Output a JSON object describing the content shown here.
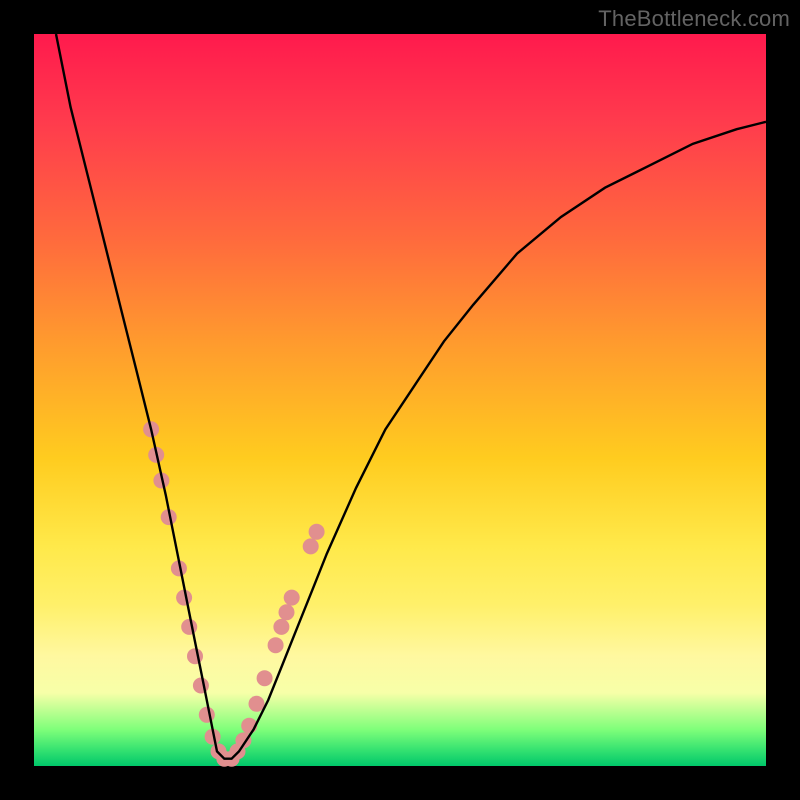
{
  "watermark": "TheBottleneck.com",
  "chart_data": {
    "type": "line",
    "title": "",
    "xlabel": "",
    "ylabel": "",
    "xlim": [
      0,
      100
    ],
    "ylim": [
      0,
      100
    ],
    "grid": false,
    "legend": false,
    "series": [
      {
        "name": "curve",
        "color": "#000000",
        "x": [
          3,
          5,
          8,
          10,
          12,
          14,
          16,
          18,
          19,
          20,
          21,
          22,
          23,
          24,
          25,
          26,
          27,
          28,
          30,
          32,
          34,
          36,
          38,
          40,
          44,
          48,
          52,
          56,
          60,
          66,
          72,
          78,
          84,
          90,
          96,
          100
        ],
        "y": [
          100,
          90,
          78,
          70,
          62,
          54,
          46,
          37,
          32,
          27,
          22,
          17,
          12,
          7,
          2,
          1,
          1,
          2,
          5,
          9,
          14,
          19,
          24,
          29,
          38,
          46,
          52,
          58,
          63,
          70,
          75,
          79,
          82,
          85,
          87,
          88
        ]
      }
    ],
    "markers": {
      "name": "highlight-dots",
      "color": "#e18f8f",
      "radius": 8,
      "points": [
        {
          "x": 16.0,
          "y": 46
        },
        {
          "x": 16.7,
          "y": 42.5
        },
        {
          "x": 17.4,
          "y": 39
        },
        {
          "x": 18.4,
          "y": 34
        },
        {
          "x": 19.8,
          "y": 27
        },
        {
          "x": 20.5,
          "y": 23
        },
        {
          "x": 21.2,
          "y": 19
        },
        {
          "x": 22.0,
          "y": 15
        },
        {
          "x": 22.8,
          "y": 11
        },
        {
          "x": 23.6,
          "y": 7
        },
        {
          "x": 24.4,
          "y": 4
        },
        {
          "x": 25.2,
          "y": 2
        },
        {
          "x": 26.0,
          "y": 1
        },
        {
          "x": 27.0,
          "y": 1
        },
        {
          "x": 27.8,
          "y": 2
        },
        {
          "x": 28.6,
          "y": 3.5
        },
        {
          "x": 29.4,
          "y": 5.5
        },
        {
          "x": 30.4,
          "y": 8.5
        },
        {
          "x": 31.5,
          "y": 12
        },
        {
          "x": 33.0,
          "y": 16.5
        },
        {
          "x": 33.8,
          "y": 19
        },
        {
          "x": 34.5,
          "y": 21
        },
        {
          "x": 35.2,
          "y": 23
        },
        {
          "x": 37.8,
          "y": 30
        },
        {
          "x": 38.6,
          "y": 32
        }
      ]
    }
  }
}
